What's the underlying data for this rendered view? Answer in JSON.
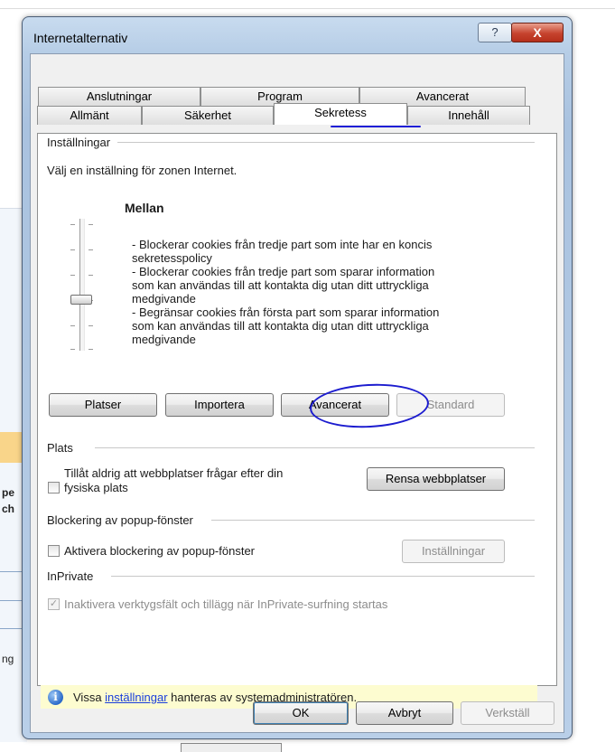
{
  "background": {
    "fragment_1": "pe",
    "fragment_2": "ch",
    "fragment_3": "ng"
  },
  "window": {
    "title": "Internetalternativ",
    "help_label": "?",
    "close_label": "X"
  },
  "tabs": {
    "row_back": [
      "Anslutningar",
      "Program",
      "Avancerat"
    ],
    "row_front": [
      "Allmänt",
      "Säkerhet",
      "Sekretess",
      "Innehåll"
    ],
    "active": "Sekretess"
  },
  "settings": {
    "heading": "Inställningar",
    "zone_text": "Välj en inställning för zonen Internet.",
    "level": "Mellan",
    "level_position": "middle",
    "descriptions": [
      "- Blockerar cookies från tredje part som inte har en koncis",
      "sekretesspolicy",
      "- Blockerar cookies från tredje part som sparar information",
      "som kan användas till att kontakta dig utan ditt uttryckliga",
      "medgivande",
      "- Begränsar cookies från första part som sparar information",
      "som kan användas till att kontakta dig utan ditt uttryckliga",
      "medgivande"
    ],
    "buttons": {
      "sites": "Platser",
      "import": "Importera",
      "advanced": "Avancerat",
      "default": "Standard"
    }
  },
  "location": {
    "heading": "Plats",
    "checkbox_label_1": "Tillåt aldrig att webbplatser frågar efter din",
    "checkbox_label_2": "fysiska plats",
    "checked": false,
    "clear_button": "Rensa webbplatser"
  },
  "popup": {
    "heading": "Blockering av popup-fönster",
    "checkbox_label": "Aktivera blockering av popup-fönster",
    "checked": false,
    "settings_button": "Inställningar"
  },
  "inprivate": {
    "heading": "InPrivate",
    "checkbox_label": "Inaktivera verktygsfält och tillägg när InPrivate-surfning startas",
    "checked": true,
    "disabled": true
  },
  "info": {
    "icon": "info-icon",
    "prefix": "Vissa ",
    "link": "inställningar",
    "suffix": " hanteras av systemadministratören."
  },
  "footer": {
    "ok": "OK",
    "cancel": "Avbryt",
    "apply": "Verkställ"
  },
  "colors": {
    "annotation_ink": "#1c1ccf",
    "close_button": "#c6432e",
    "info_background": "#fdfcd0",
    "link": "#1a3edb"
  }
}
